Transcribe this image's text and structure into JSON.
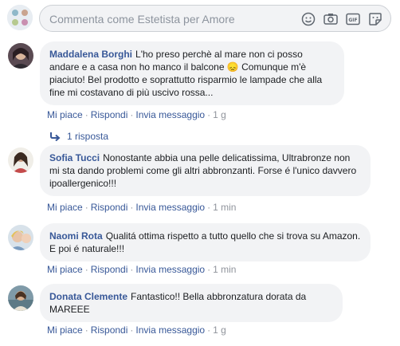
{
  "composer": {
    "placeholder": "Commenta come Estetista per Amore",
    "icons": [
      "emoji-icon",
      "camera-icon",
      "gif-icon",
      "sticker-icon"
    ]
  },
  "comments": [
    {
      "author": "Maddalena Borghi",
      "text": "L'ho preso perchè al mare non ci posso andare e a casa non ho manco il balcone 😞 Comunque m'è piaciuto! Bel prodotto e soprattutto risparmio le lampade che alla fine mi costavano di più uscivo rossa...",
      "like": "Mi piace",
      "reply": "Rispondi",
      "message": "Invia messaggio",
      "time": "1 g"
    },
    {
      "author": "Sofia Tucci",
      "text": "Nonostante abbia una pelle delicatissima, Ultrabronze non mi sta dando problemi come gli altri abbronzanti. Forse é l'unico davvero ipoallergenico!!!",
      "like": "Mi piace",
      "reply": "Rispondi",
      "message": "Invia messaggio",
      "time": "1 min"
    },
    {
      "author": "Naomi Rota",
      "text": "Qualitá ottima rispetto a tutto quello che si trova su Amazon. E poi é naturale!!!",
      "like": "Mi piace",
      "reply": "Rispondi",
      "message": "Invia messaggio",
      "time": "1 min"
    },
    {
      "author": "Donata Clemente",
      "text": "Fantastico!! Bella abbronzatura dorata da MAREEE",
      "like": "Mi piace",
      "reply": "Rispondi",
      "message": "Invia messaggio",
      "time": "1 g"
    }
  ],
  "replies_label": "1 risposta",
  "colors": {
    "link": "#385898",
    "bubble": "#f2f3f5",
    "meta": "#90949c"
  }
}
